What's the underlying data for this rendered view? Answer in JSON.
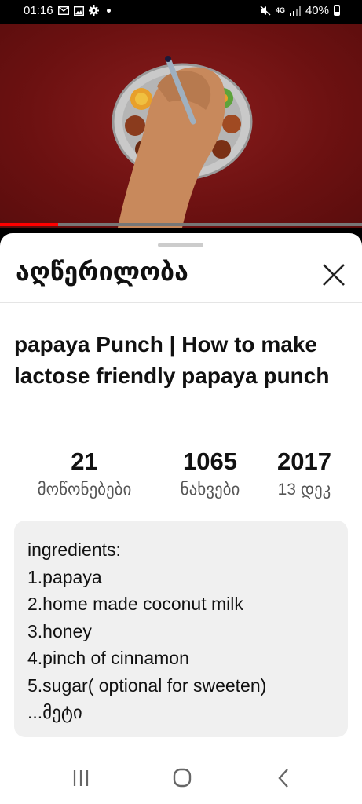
{
  "status_bar": {
    "time": "01:16",
    "network": "4G",
    "battery": "40%",
    "icons": [
      "gmail-icon",
      "gallery-icon",
      "settings-icon",
      "notification-dot",
      "mute-icon",
      "signal-icon",
      "battery-icon"
    ]
  },
  "video": {
    "progress_fraction": 0.16,
    "progress_color": "#ff0000",
    "background_color": "#6c1111"
  },
  "sheet": {
    "header_title": "აღწერილობა",
    "title": "papaya Punch | How to make lactose friendly papaya punch",
    "stats": [
      {
        "value": "21",
        "label": "მოწონებები"
      },
      {
        "value": "1065",
        "label": "ნახვები"
      },
      {
        "value": "2017",
        "label": "13 დეკ"
      }
    ],
    "description_lines": [
      "ingredients:",
      "1.papaya",
      "2.home made coconut milk",
      "3.honey",
      "4.pinch of cinnamon",
      "5.sugar( optional for sweeten)"
    ],
    "more_label": "...მეტი"
  },
  "nav_bar": {
    "buttons": [
      "recent-apps",
      "home",
      "back"
    ]
  }
}
